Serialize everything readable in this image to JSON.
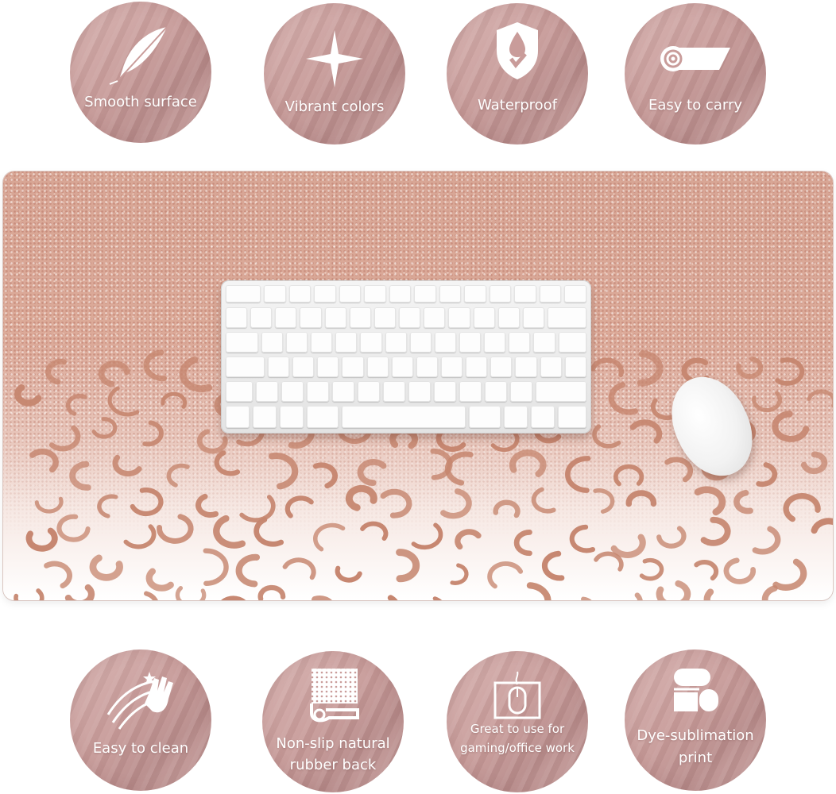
{
  "features_top": [
    {
      "label": "Smooth surface",
      "icon": "feather-icon"
    },
    {
      "label": "Vibrant colors",
      "icon": "sparkle-icon"
    },
    {
      "label": "Waterproof",
      "icon": "shield-drop-icon"
    },
    {
      "label": "Easy to carry",
      "icon": "rolled-mat-icon"
    }
  ],
  "features_bottom": [
    {
      "label": "Easy to clean",
      "icon": "wipe-hand-icon"
    },
    {
      "label_line1": "Non-slip natural",
      "label_line2": "rubber back",
      "icon": "rubber-dots-icon"
    },
    {
      "label_line1": "Great to use for",
      "label_line2": "gaming/office work",
      "icon": "mouse-on-pad-icon"
    },
    {
      "label_line1": "Dye-sublimation",
      "label_line2": "print",
      "icon": "print-rollers-icon"
    }
  ],
  "colors": {
    "badge": "#c99c9a",
    "glitter": "#d8a695",
    "leopard_spot": "#c6866f",
    "mat_white": "#ffffff"
  }
}
